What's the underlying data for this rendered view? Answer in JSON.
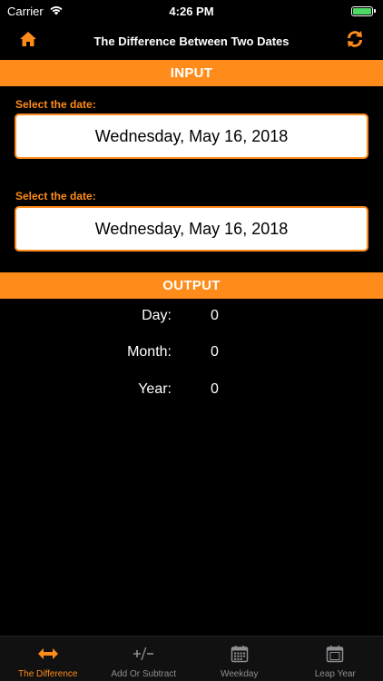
{
  "status_bar": {
    "carrier": "Carrier",
    "time": "4:26 PM"
  },
  "nav": {
    "title": "The Difference Between Two Dates",
    "left_icon": "home-icon",
    "right_icon": "swap-icon"
  },
  "input": {
    "header": "INPUT",
    "fields": [
      {
        "label": "Select the date:",
        "value": "Wednesday, May 16, 2018"
      },
      {
        "label": "Select the date:",
        "value": "Wednesday, May 16, 2018"
      }
    ]
  },
  "output": {
    "header": "OUTPUT",
    "rows": [
      {
        "label": "Day:",
        "value": "0"
      },
      {
        "label": "Month:",
        "value": "0"
      },
      {
        "label": "Year:",
        "value": "0"
      }
    ]
  },
  "tabs": [
    {
      "label": "The Difference",
      "icon": "arrows-horizontal-icon",
      "active": true
    },
    {
      "label": "Add Or Subtract",
      "icon": "plus-minus-icon",
      "active": false
    },
    {
      "label": "Weekday",
      "icon": "calendar-icon",
      "active": false
    },
    {
      "label": "Leap Year",
      "icon": "calendar-29-icon",
      "active": false
    }
  ],
  "colors": {
    "accent": "#ff8c1a",
    "background": "#000000",
    "field_bg": "#ffffff",
    "tab_inactive": "#8e8e93"
  }
}
